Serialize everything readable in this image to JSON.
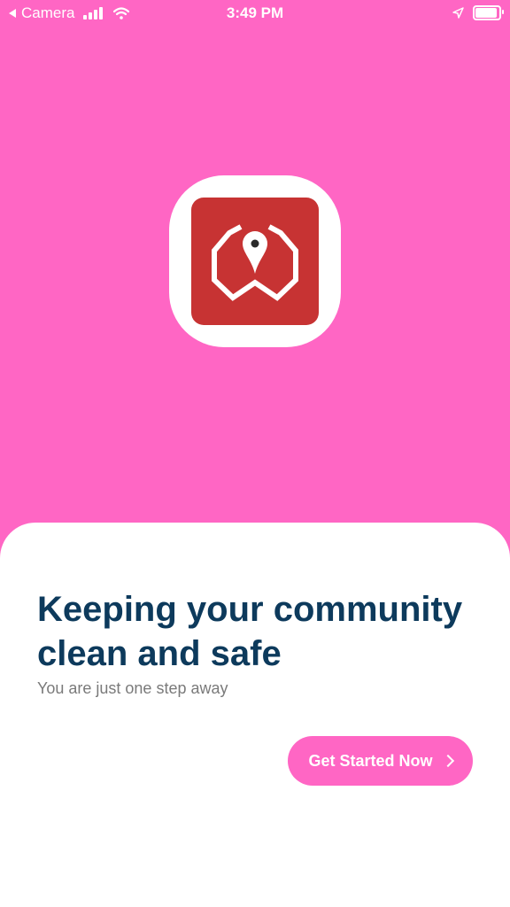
{
  "status_bar": {
    "back_app": "Camera",
    "time": "3:49 PM"
  },
  "colors": {
    "background": "#ff66c4",
    "logo_red": "#c73333",
    "headline": "#0d3a5c",
    "subtitle": "#7a7a7a",
    "button": "#ff66c4"
  },
  "welcome": {
    "headline": "Keeping your community clean and safe",
    "subtitle": "You are just one step away",
    "cta_label": "Get Started Now"
  },
  "icons": {
    "status": [
      "back-arrow-icon",
      "signal-icon",
      "wifi-icon",
      "location-arrow-icon",
      "battery-icon"
    ],
    "logo": "hexagon-location-pin-logo",
    "cta": "chevron-right-icon"
  }
}
